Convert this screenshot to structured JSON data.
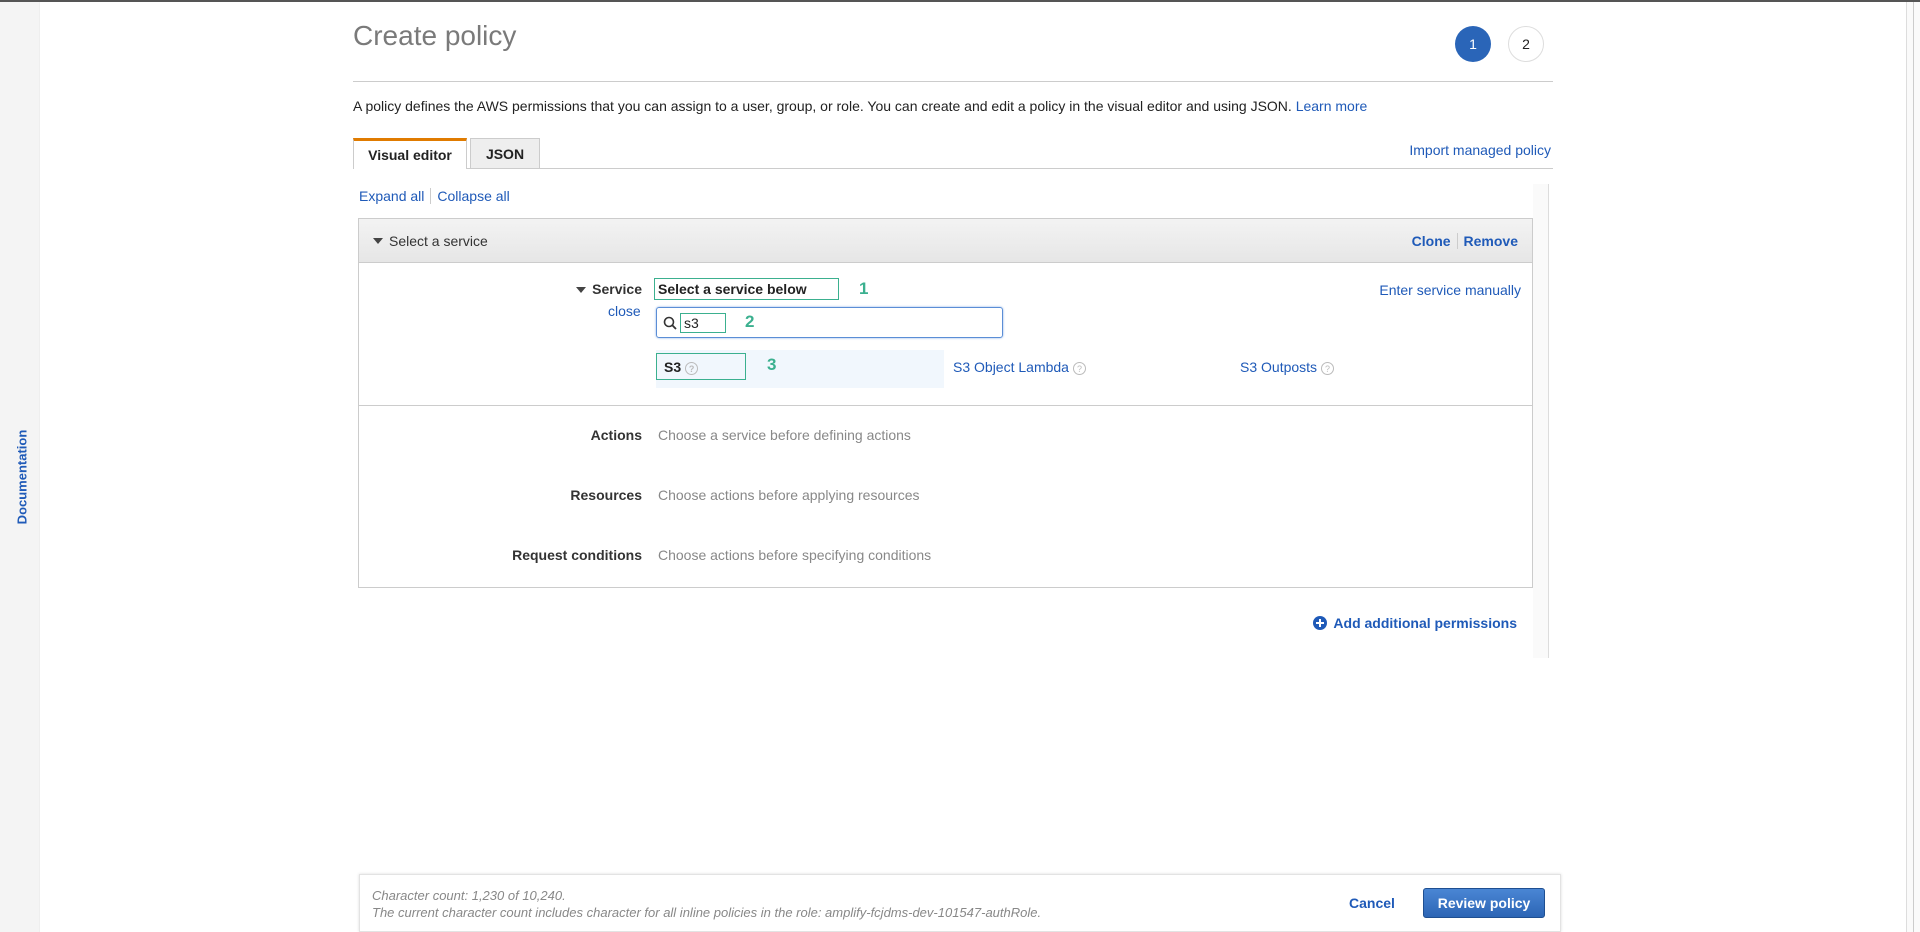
{
  "sidebar": {
    "documentation": "Documentation"
  },
  "header": {
    "title": "Create policy",
    "steps": [
      "1",
      "2"
    ],
    "active_step": 1
  },
  "description": {
    "text": "A policy defines the AWS permissions that you can assign to a user, group, or role. You can create and edit a policy in the visual editor and using JSON.",
    "learn_more": "Learn more"
  },
  "tabs": [
    {
      "label": "Visual editor",
      "active": true
    },
    {
      "label": "JSON",
      "active": false
    }
  ],
  "import_label": "Import managed policy",
  "expand_all": "Expand all",
  "collapse_all": "Collapse all",
  "panel": {
    "title": "Select a service",
    "clone": "Clone",
    "remove": "Remove",
    "service": {
      "label": "Service",
      "close": "close",
      "selected": "Select a service below",
      "enter_manually": "Enter service manually",
      "search_value": "s3",
      "results": [
        {
          "label": "S3",
          "help": "?"
        },
        {
          "label": "S3 Object Lambda",
          "help": "?"
        },
        {
          "label": "S3 Outposts",
          "help": "?"
        }
      ]
    },
    "annotations": [
      "1",
      "2",
      "3"
    ],
    "rows": [
      {
        "label": "Actions",
        "value": "Choose a service before defining actions"
      },
      {
        "label": "Resources",
        "value": "Choose actions before applying resources"
      },
      {
        "label": "Request conditions",
        "value": "Choose actions before specifying conditions"
      }
    ]
  },
  "add_permissions": "Add additional permissions",
  "footer": {
    "char_count": "Character count: 1,230 of 10,240.",
    "note": "The current character count includes character for all inline policies in the role: amplify-fcjdms-dev-101547-authRole.",
    "cancel": "Cancel",
    "review": "Review policy"
  },
  "colors": {
    "accent": "#1f5ab8",
    "tab_active": "#e07b00",
    "annotation": "#3bb08f",
    "primary_button": "#2c65b5"
  }
}
